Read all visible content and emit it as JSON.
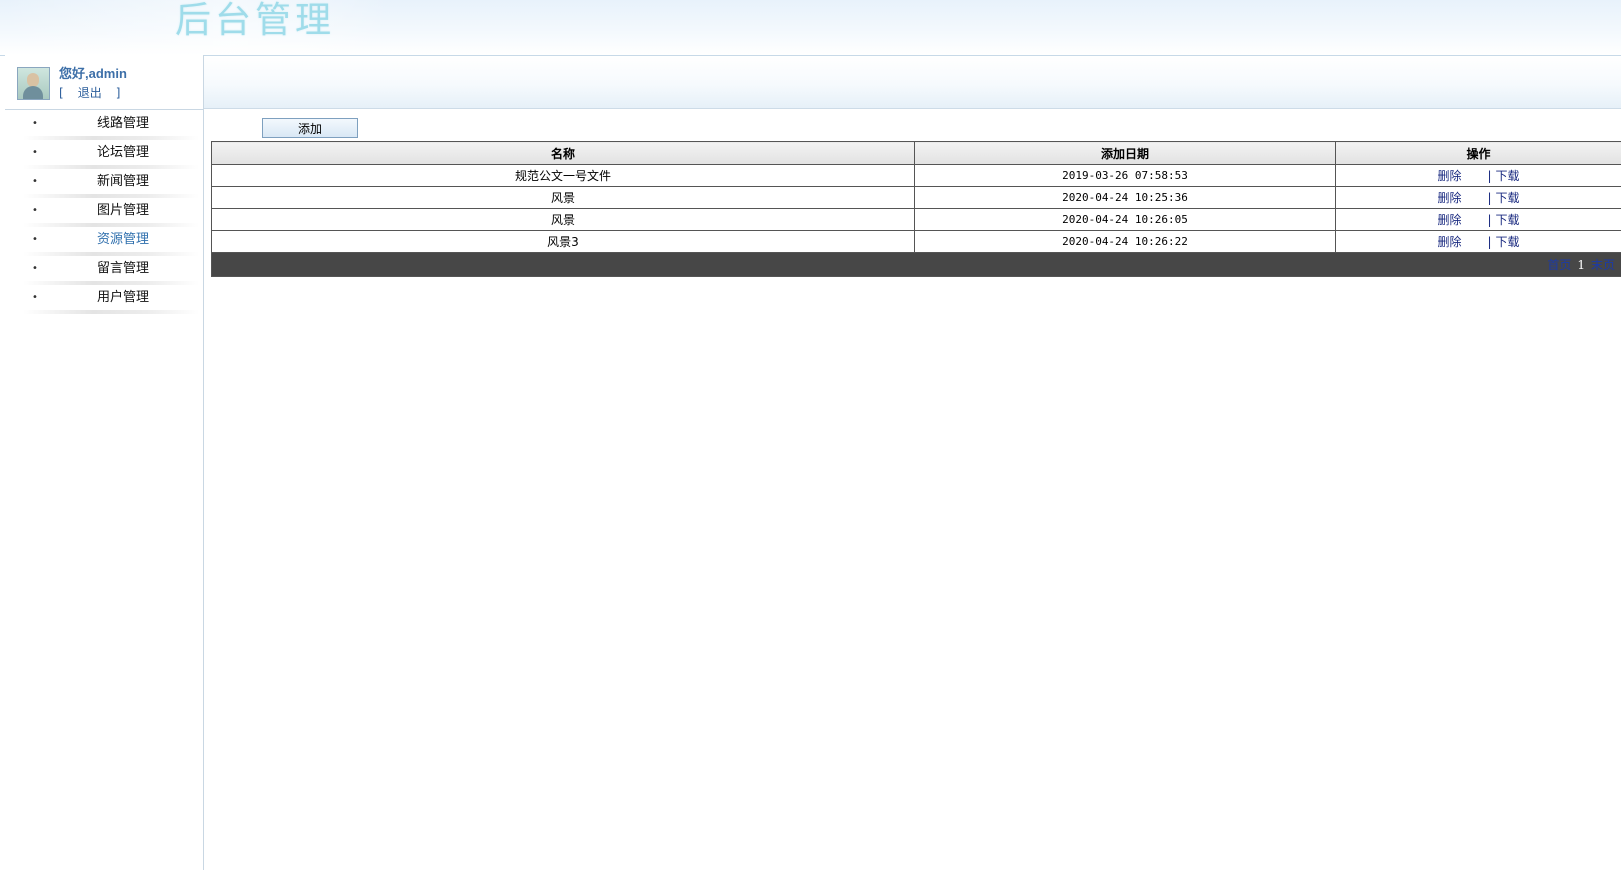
{
  "header": {
    "title": "后台管理"
  },
  "user": {
    "greeting": "您好,admin",
    "bracket_open": "[",
    "logout_label": "退出",
    "bracket_close": "]"
  },
  "menu": {
    "bullet": "•",
    "items": [
      {
        "label": "线路管理"
      },
      {
        "label": "论坛管理"
      },
      {
        "label": "新闻管理"
      },
      {
        "label": "图片管理"
      },
      {
        "label": "资源管理"
      },
      {
        "label": "留言管理"
      },
      {
        "label": "用户管理"
      }
    ],
    "active_index": 4
  },
  "toolbar": {
    "add_label": "添加"
  },
  "table": {
    "columns": [
      "名称",
      "添加日期",
      "操作"
    ],
    "rows": [
      {
        "name": "规范公文一号文件",
        "date": "2019-03-26 07:58:53"
      },
      {
        "name": "风景",
        "date": "2020-04-24 10:25:36"
      },
      {
        "name": "风景",
        "date": "2020-04-24 10:26:05"
      },
      {
        "name": "风景3",
        "date": "2020-04-24 10:26:22"
      }
    ],
    "actions": {
      "delete_label": "删除",
      "separator": "|",
      "download_label": "下载"
    }
  },
  "pager": {
    "first_label": "首页",
    "current_page": "1",
    "last_label": "末页"
  },
  "colors": {
    "title": "#9fdcea",
    "link": "#1a2a80",
    "active_menu": "#2f6fad",
    "pager_bar": "#474747"
  }
}
